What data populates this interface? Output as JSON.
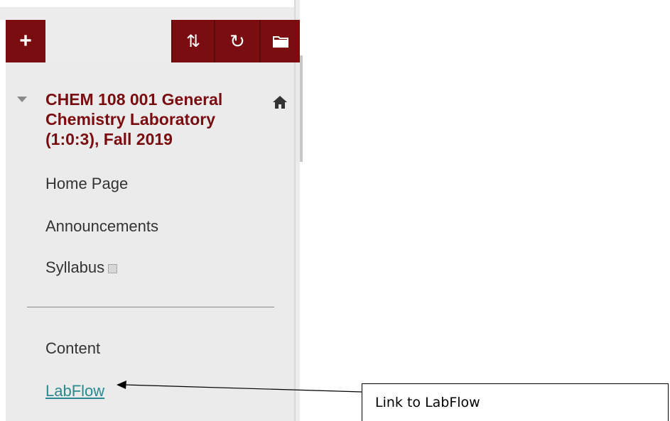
{
  "toolbar": {
    "add_icon": "+",
    "sort_icon": "⇅",
    "refresh_icon": "↻",
    "folder_icon": "folder-icon",
    "accent_color": "#7a0d10"
  },
  "course": {
    "title": "CHEM 108 001 General Chemistry Laboratory (1:0:3), Fall 2019",
    "title_color": "#7a0d10"
  },
  "menu": {
    "items": [
      {
        "label": "Home Page"
      },
      {
        "label": "Announcements"
      },
      {
        "label": "Syllabus"
      },
      {
        "label": "Content"
      },
      {
        "label": "LabFlow"
      }
    ],
    "link_color": "#2a8a8f"
  },
  "annotation": {
    "text": "Link to LabFlow"
  }
}
